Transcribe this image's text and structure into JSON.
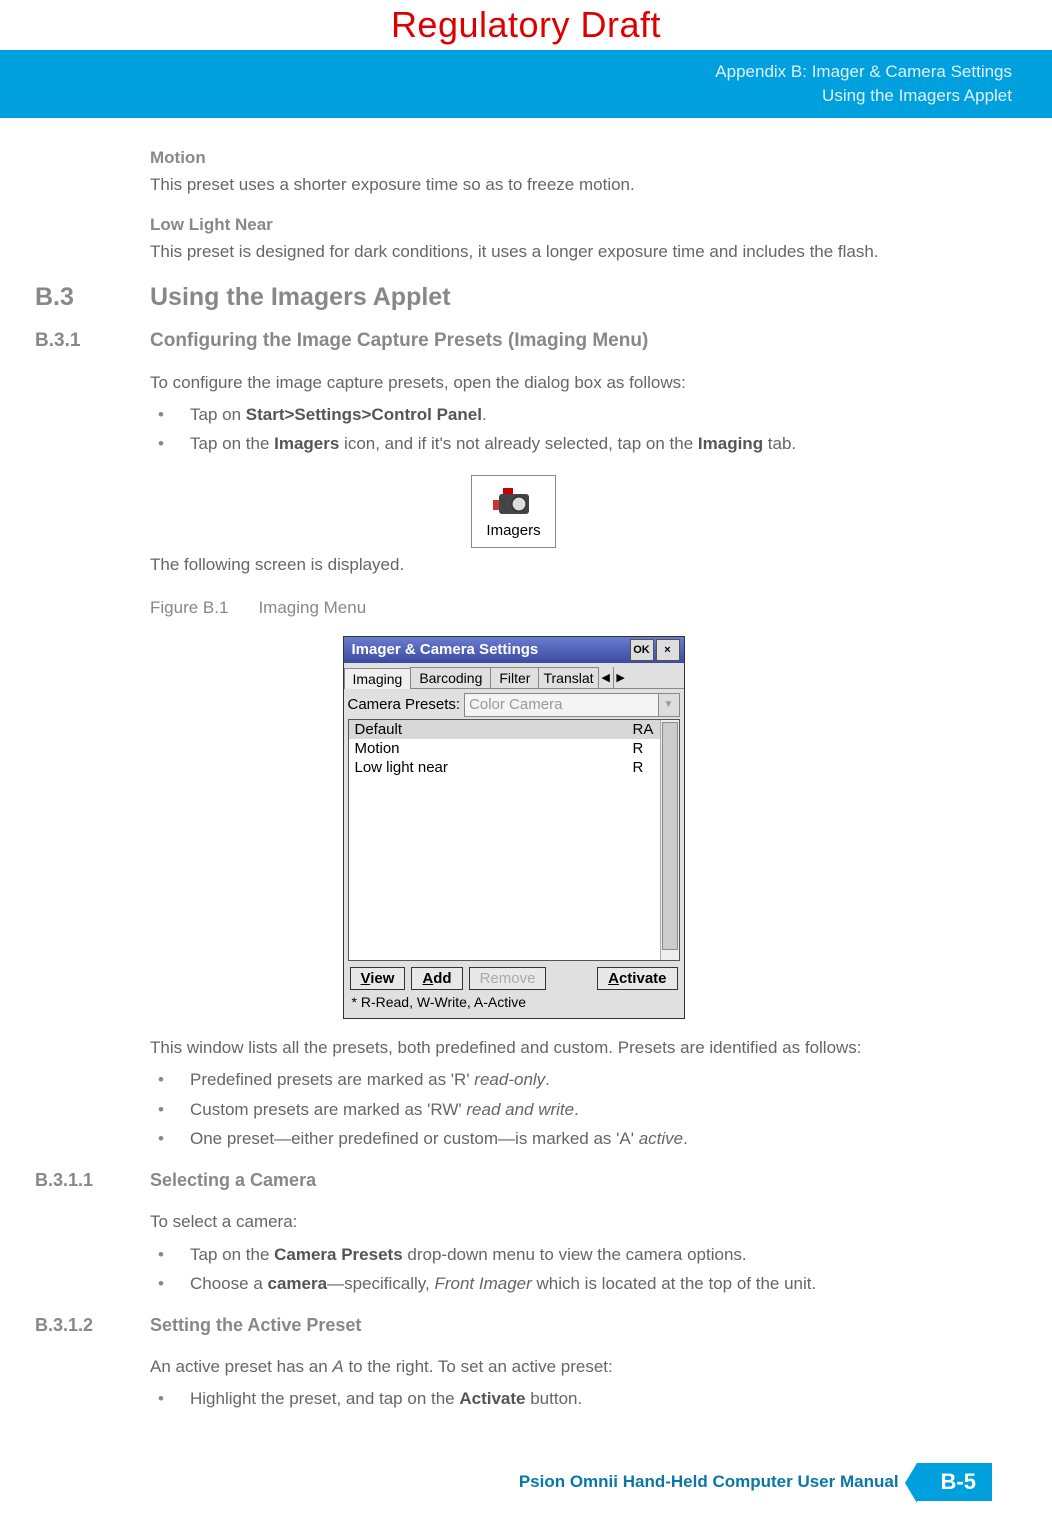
{
  "watermark": "Regulatory Draft",
  "header": {
    "line1": "Appendix B: Imager & Camera Settings",
    "line2": "Using the Imagers Applet"
  },
  "motion": {
    "title": "Motion",
    "text": "This preset uses a shorter exposure time so as to freeze motion."
  },
  "lowlight": {
    "title": "Low Light Near",
    "text": "This preset is designed for dark conditions, it uses a longer exposure time and includes the flash."
  },
  "b3": {
    "num": "B.3",
    "title": "Using the Imagers Applet"
  },
  "b31": {
    "num": "B.3.1",
    "title": "Configuring the Image Capture Presets (Imaging Menu)",
    "intro": "To configure the image capture presets, open the dialog box as follows:",
    "li1_a": "Tap on ",
    "li1_b": "Start>Settings>Control Panel",
    "li1_c": ".",
    "li2_a": "Tap on the ",
    "li2_b": "Imagers",
    "li2_c": " icon, and if it's not already selected, tap on the ",
    "li2_d": "Imaging",
    "li2_e": " tab.",
    "after_icon": "The following screen is displayed.",
    "after_window": "This window lists all the presets, both predefined and custom. Presets are identified as follows:",
    "li3_a": "Predefined presets are marked as 'R' ",
    "li3_b": "read-only",
    "li3_c": ".",
    "li4_a": "Custom presets are marked as 'RW' ",
    "li4_b": "read and write",
    "li4_c": ".",
    "li5_a": "One preset—either predefined or custom—is marked as 'A' ",
    "li5_b": "active",
    "li5_c": "."
  },
  "icon_label": "Imagers",
  "figure": {
    "num": "Figure B.1",
    "title": "Imaging Menu"
  },
  "app": {
    "title": "Imager & Camera Settings",
    "ok": "OK",
    "close": "×",
    "tabs": [
      "Imaging",
      "Barcoding",
      "Filter",
      "Translat"
    ],
    "presets_label": "Camera Presets:",
    "presets_value": "Color Camera",
    "rows": [
      {
        "name": "Default",
        "flag": "RA"
      },
      {
        "name": "Motion",
        "flag": "R"
      },
      {
        "name": "Low light near",
        "flag": "R"
      }
    ],
    "buttons": {
      "view": "View",
      "add": "Add",
      "remove": "Remove",
      "activate": "Activate"
    },
    "legend": "* R-Read, W-Write, A-Active"
  },
  "b3111": {
    "num": "B.3.1.1",
    "title": "Selecting a Camera",
    "intro": "To select a camera:",
    "li1_a": "Tap on the ",
    "li1_b": "Camera Presets",
    "li1_c": " drop-down menu to view the camera options.",
    "li2_a": "Choose a ",
    "li2_b": "camera",
    "li2_c": "—specifically, ",
    "li2_d": "Front Imager",
    "li2_e": " which is located at the top of the unit."
  },
  "b3112": {
    "num": "B.3.1.2",
    "title": "Setting the Active Preset",
    "intro_a": "An active preset has an ",
    "intro_b": "A",
    "intro_c": " to the right. To set an active preset:",
    "li1_a": "Highlight the preset, and tap on the ",
    "li1_b": "Activate",
    "li1_c": " button."
  },
  "footer": {
    "text": "Psion Omnii Hand-Held Computer User Manual",
    "page": "B-5"
  }
}
